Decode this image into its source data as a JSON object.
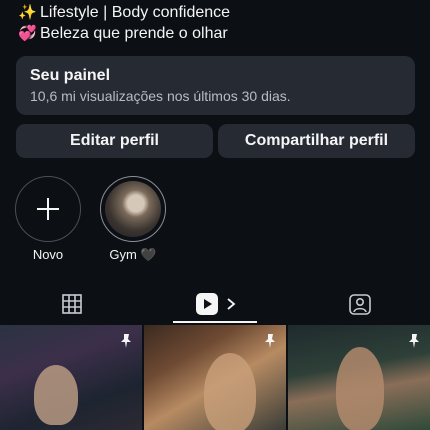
{
  "bio": {
    "line1": "Lifestyle | Body confidence",
    "line2": "Beleza que prende o olhar"
  },
  "panel": {
    "title": "Seu painel",
    "subtitle": "10,6 mi visualizações nos últimos 30 dias."
  },
  "buttons": {
    "edit": "Editar perfil",
    "share": "Compartilhar perfil"
  },
  "highlights": [
    {
      "label": "Novo"
    },
    {
      "label": "Gym 🖤"
    }
  ],
  "tabs": {
    "icons": [
      "grid-icon",
      "reels-icon",
      "tagged-icon"
    ],
    "active": "reels"
  },
  "posts": [
    {
      "pinned": true
    },
    {
      "pinned": true
    },
    {
      "pinned": true
    }
  ]
}
